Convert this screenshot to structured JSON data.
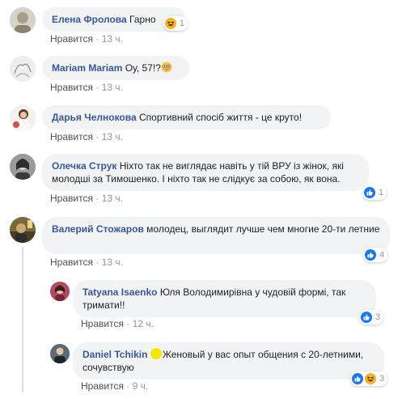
{
  "colors": {
    "author": "#385898",
    "bubble": "#f2f3f5",
    "meta": "#90949c",
    "like_blue": "#1877f2",
    "haha_yellow": "#f7b125"
  },
  "comments": [
    {
      "author": "Елена Фролова",
      "text": "Гарно",
      "like_label": "Нравится",
      "time": "13 ч.",
      "reactions": [
        "haha-icon"
      ],
      "reaction_count": "1"
    },
    {
      "author": "Mariam Mariam",
      "text": "Оу, 57!?",
      "emoji": "flushed-face-icon",
      "like_label": "Нравится",
      "time": "13 ч."
    },
    {
      "author": "Дарья Челнокова",
      "text": "Спортивний спосіб життя - це круто!",
      "like_label": "Нравится",
      "time": "13 ч."
    },
    {
      "author": "Олечка Струк",
      "text": "Ніхто так не виглядає навіть у тій ВРУ із жінок, які молодші за Тимошенко. І ніхто так не слідкує за собою, як вона.",
      "like_label": "Нравится",
      "time": "13 ч.",
      "reactions": [
        "like-icon"
      ],
      "reaction_count": "1"
    },
    {
      "author": "Валерий Стожаров",
      "text": "молодец, выглядит лучше чем многие 20-ти летние",
      "like_label": "Нравится",
      "time": "13 ч.",
      "reactions": [
        "like-icon"
      ],
      "reaction_count": "4"
    }
  ],
  "replies": [
    {
      "author": "Tatyana Isaenko",
      "text": "Юля Володимирівна у чудовій формі, так тримати!!",
      "like_label": "Нравится",
      "time": "12 ч.",
      "reactions": [
        "like-icon"
      ],
      "reaction_count": "3"
    },
    {
      "author": "Daniel Tchikin",
      "text_prefix": "Ж",
      "text": "еновый у вас опыт общения с 20-летними, сочувствую",
      "like_label": "Нравится",
      "time": "9 ч.",
      "reactions": [
        "like-icon",
        "haha-icon"
      ],
      "reaction_count": "3"
    }
  ]
}
